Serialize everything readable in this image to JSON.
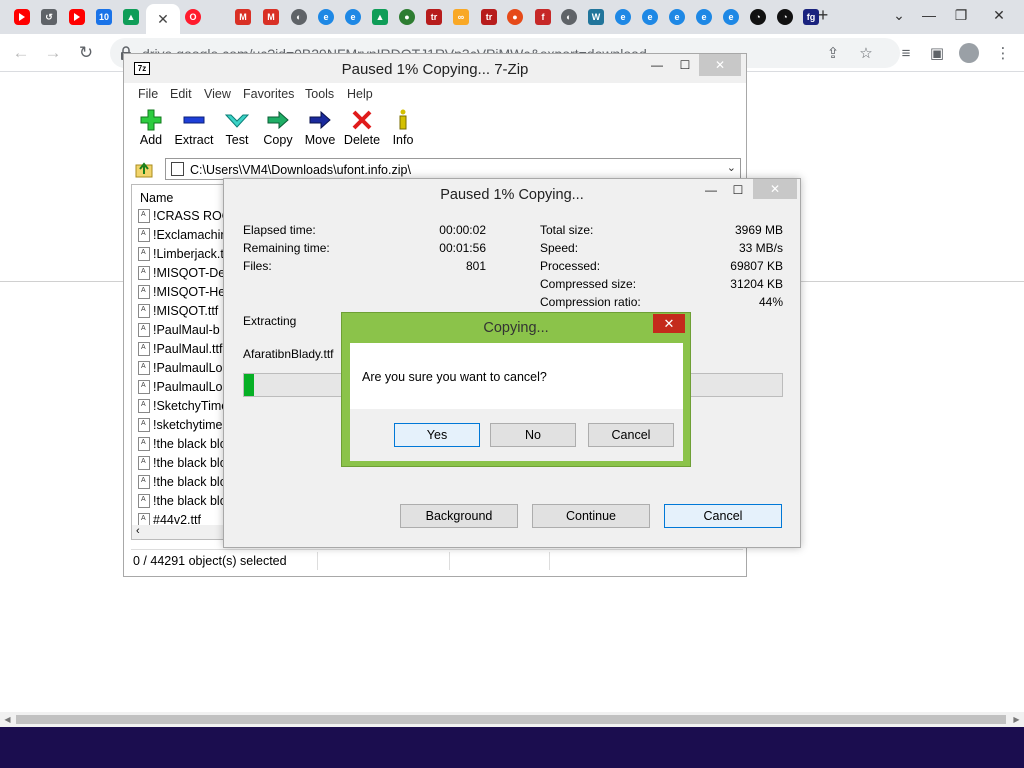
{
  "browser": {
    "tabs": [
      {
        "icon": "youtube-icon",
        "color": "#ff0000"
      },
      {
        "icon": "history-icon",
        "color": "#5f6368",
        "text": "↺"
      },
      {
        "icon": "youtube-icon",
        "color": "#ff0000"
      },
      {
        "icon": "calendar-icon",
        "color": "#1a73e8",
        "text": "10"
      },
      {
        "icon": "google-drive-icon",
        "color": "#0f9d58",
        "text": "▲"
      },
      {
        "icon": "opera-icon",
        "color": "#ff1b2d",
        "text": "O"
      },
      {
        "icon": "gmail-icon",
        "color": "#d93025",
        "text": "M"
      },
      {
        "icon": "gmail-icon",
        "color": "#d93025",
        "text": "M"
      },
      {
        "icon": "globe-icon",
        "color": "#5f6368",
        "text": "◐"
      },
      {
        "icon": "edge-icon",
        "color": "#1e88e5",
        "text": "e"
      },
      {
        "icon": "edge-icon",
        "color": "#1e88e5",
        "text": "e"
      },
      {
        "icon": "google-drive-icon",
        "color": "#0f9d58",
        "text": "▲"
      },
      {
        "icon": "earth-icon",
        "color": "#2e7d32",
        "text": "●"
      },
      {
        "icon": "tr-icon",
        "color": "#b71c1c",
        "text": "tr"
      },
      {
        "icon": "glasses-icon",
        "color": "#f9a825",
        "text": "∞"
      },
      {
        "icon": "tr-icon",
        "color": "#b71c1c",
        "text": "tr"
      },
      {
        "icon": "basketball-icon",
        "color": "#e64a19",
        "text": "●"
      },
      {
        "icon": "red-f-icon",
        "color": "#c62828",
        "text": "f"
      },
      {
        "icon": "globe-icon",
        "color": "#5f6368",
        "text": "◐"
      },
      {
        "icon": "wordpress-icon",
        "color": "#21759b",
        "text": "W"
      },
      {
        "icon": "edge-icon",
        "color": "#1e88e5",
        "text": "e"
      },
      {
        "icon": "edge-icon",
        "color": "#1e88e5",
        "text": "e"
      },
      {
        "icon": "edge-icon",
        "color": "#1e88e5",
        "text": "e"
      },
      {
        "icon": "edge-icon",
        "color": "#1e88e5",
        "text": "e"
      },
      {
        "icon": "edge-icon",
        "color": "#1e88e5",
        "text": "e"
      },
      {
        "icon": "dark-circle-icon",
        "color": "#111111",
        "text": "◔"
      },
      {
        "icon": "dark-circle-icon",
        "color": "#111111",
        "text": "◔"
      },
      {
        "icon": "fg-icon",
        "color": "#1a237e",
        "text": "fg"
      }
    ],
    "active_tab_icon": "close-icon",
    "new_tab_label": "+",
    "url": "drive.google.com/uc?id=0B29NFMrvnIRDOTJ1RVp3cVPiMWc&export=download"
  },
  "zip_window": {
    "title": "Paused 1% Copying... 7-Zip",
    "logo_text": "7z",
    "menu": [
      "File",
      "Edit",
      "View",
      "Favorites",
      "Tools",
      "Help"
    ],
    "toolbar": [
      "Add",
      "Extract",
      "Test",
      "Copy",
      "Move",
      "Delete",
      "Info"
    ],
    "address": "C:\\Users\\VM4\\Downloads\\ufont.info.zip\\",
    "column_name": "Name",
    "files": [
      "!CRASS ROOTS",
      "!Exclamachine",
      "!Limberjack.ttf",
      "!MISQOT-De",
      "!MISQOT-He",
      "!MISQOT.ttf",
      "!PaulMaul-b",
      "!PaulMaul.ttf",
      "!PaulmaulLo",
      "!PaulmaulLo",
      "!SketchyTime",
      "!sketchytime",
      "!the black blo",
      "!the black blo",
      "!the black blo",
      "!the black blo",
      "#44v2.ttf"
    ],
    "status": "0 / 44291 object(s) selected"
  },
  "progress_window": {
    "title": "Paused 1% Copying...",
    "elapsed_label": "Elapsed time:",
    "elapsed_value": "00:00:02",
    "remaining_label": "Remaining time:",
    "remaining_value": "00:01:56",
    "files_label": "Files:",
    "files_value": "801",
    "total_size_label": "Total size:",
    "total_size_value": "3969 MB",
    "speed_label": "Speed:",
    "speed_value": "33 MB/s",
    "processed_label": "Processed:",
    "processed_value": "69807 KB",
    "compressed_label": "Compressed size:",
    "compressed_value": "31204 KB",
    "ratio_label": "Compression ratio:",
    "ratio_value": "44%",
    "action": "Extracting",
    "current_file": "AfaratibnBlady.ttf",
    "progress_fraction": 0.01,
    "progress_color": "#06b025",
    "background_label": "Background",
    "continue_label": "Continue",
    "cancel_label": "Cancel"
  },
  "confirm_dialog": {
    "title": "Copying...",
    "message": "Are you sure you want to cancel?",
    "yes_label": "Yes",
    "no_label": "No",
    "cancel_label": "Cancel",
    "frame_color": "#8bc34a"
  }
}
